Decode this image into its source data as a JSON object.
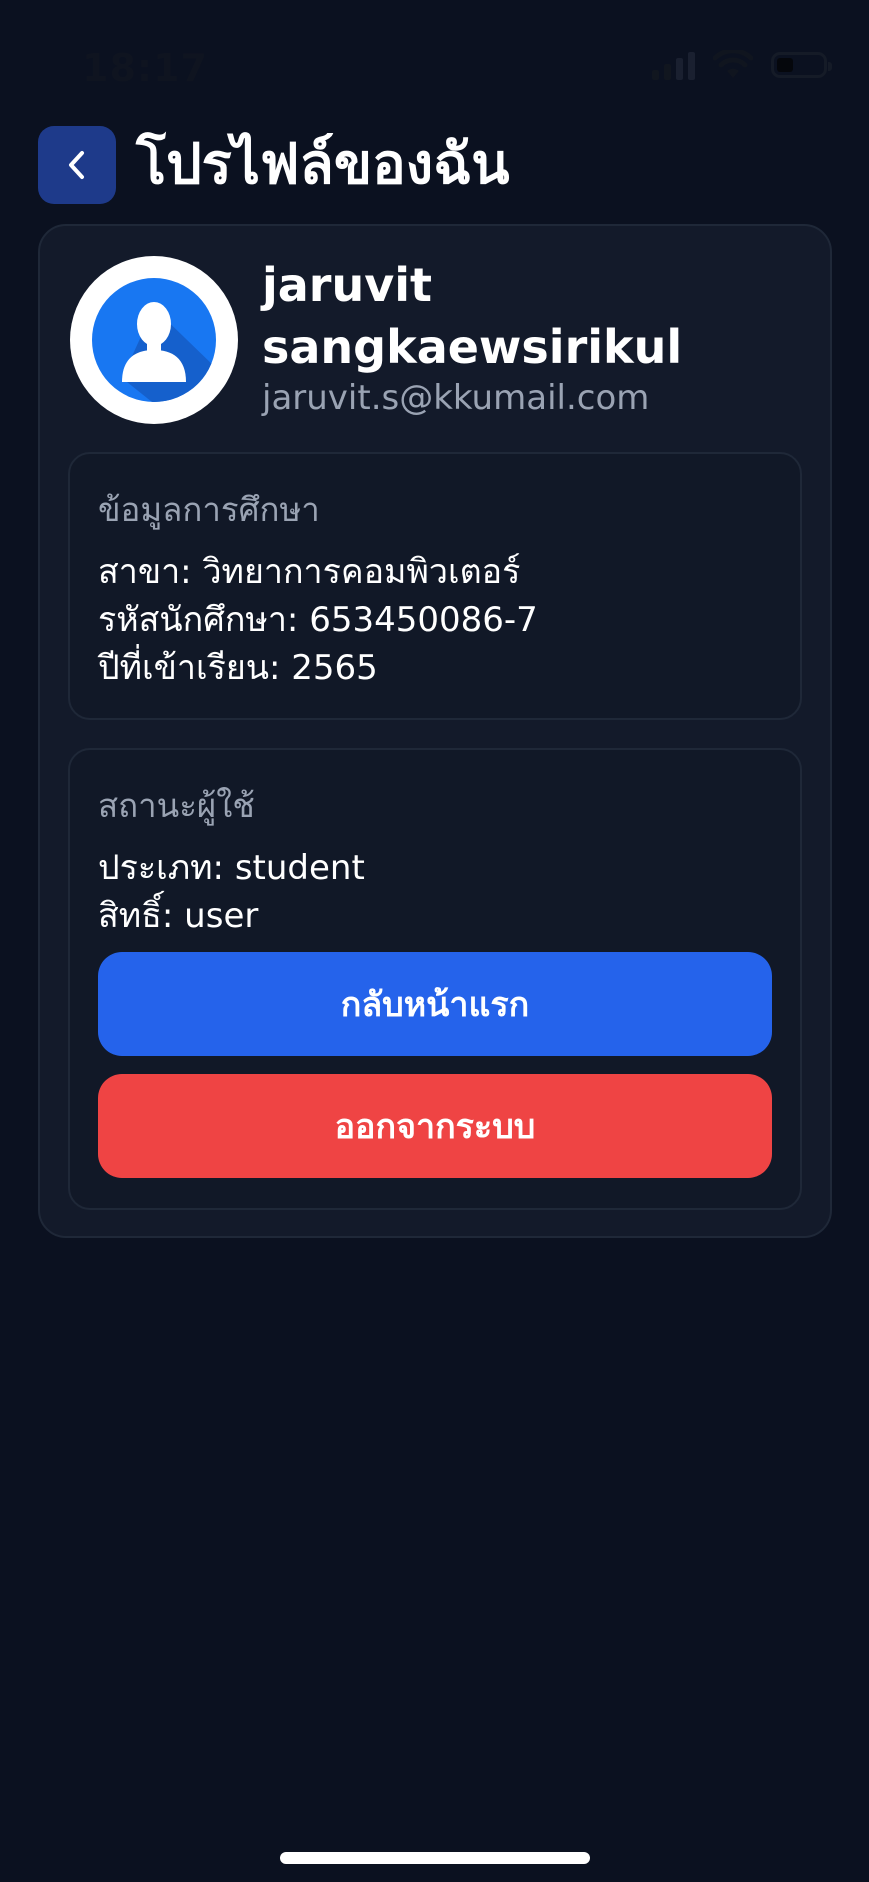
{
  "status_bar": {
    "time": "18:17"
  },
  "header": {
    "title": "โปรไฟล์ของฉัน",
    "back_icon": "chevron-left-icon"
  },
  "profile": {
    "name": "jaruvit sangkaewsirikul",
    "email": "jaruvit.s@kkumail.com",
    "avatar_icon": "user-avatar-icon"
  },
  "education": {
    "heading": "ข้อมูลการศึกษา",
    "major": "สาขา: วิทยาการคอมพิวเตอร์",
    "student_id": "รหัสนักศึกษา: 653450086-7",
    "enroll_year": "ปีที่เข้าเรียน: 2565"
  },
  "user_status": {
    "heading": "สถานะผู้ใช้",
    "type": "ประเภท: student",
    "role": "สิทธิ์: user"
  },
  "buttons": {
    "home_label": "กลับหน้าแรก",
    "logout_label": "ออกจากระบบ"
  },
  "colors": {
    "background": "#0b1120",
    "card": "#131a2a",
    "primary": "#2563eb",
    "danger": "#ef4444",
    "back_button": "#1e3a8a",
    "avatar_blue": "#1877f2"
  }
}
